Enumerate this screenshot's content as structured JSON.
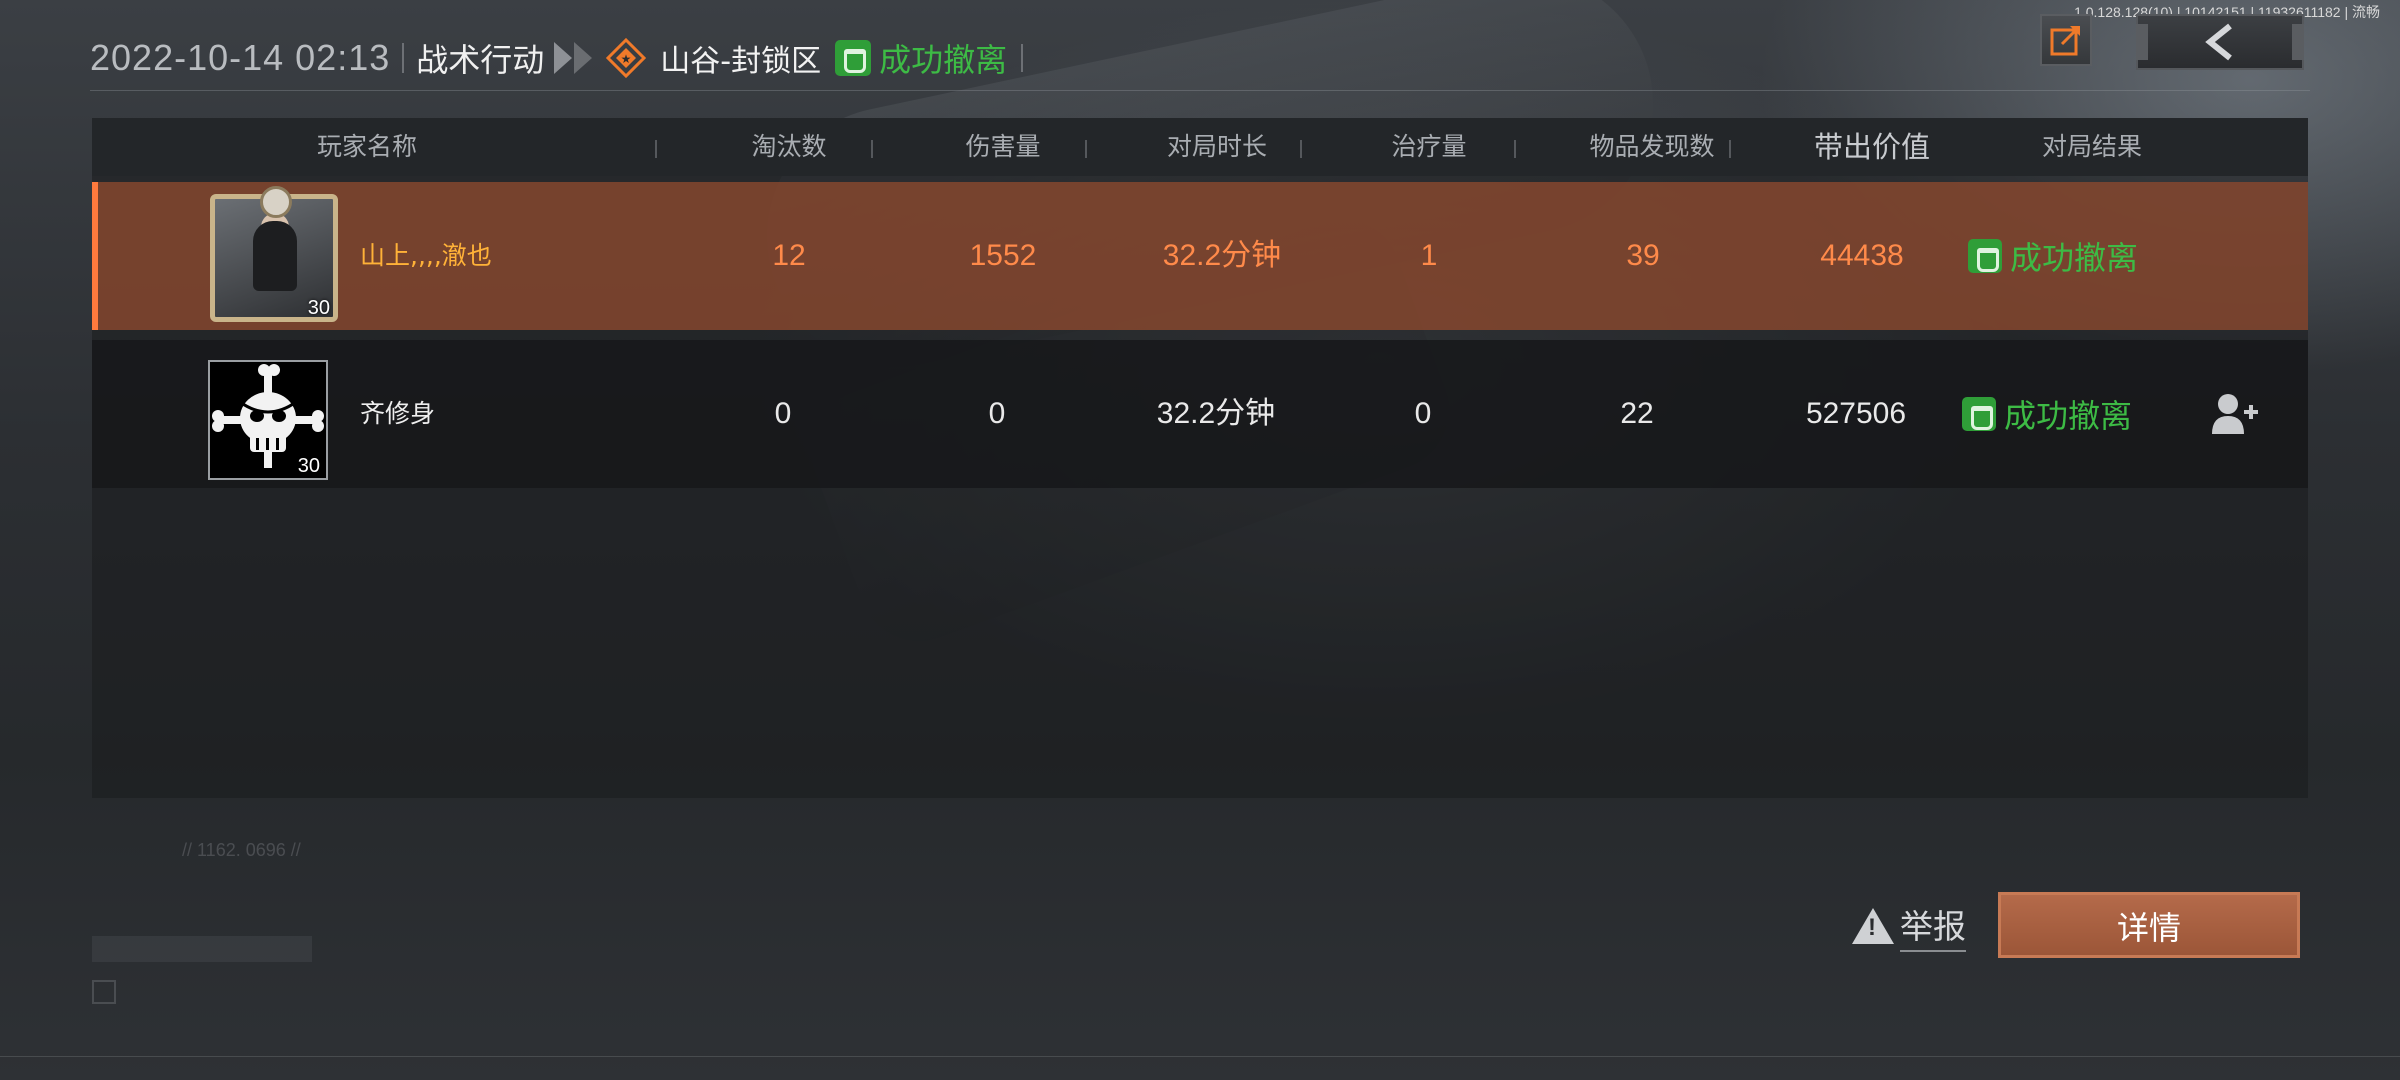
{
  "build_info": "1.0.128.128(10) | 10142151 | 11932611182 | 流畅",
  "header": {
    "datetime": "2022-10-14 02:13",
    "mode": "战术行动",
    "map": "山谷-封锁区",
    "result": "成功撤离"
  },
  "columns": [
    "玩家名称",
    "淘汰数",
    "伤害量",
    "对局时长",
    "治疗量",
    "物品发现数",
    "带出价值",
    "对局结果"
  ],
  "players": [
    {
      "name": "山上,,,,澈也",
      "level": "30",
      "kills": "12",
      "damage": "1552",
      "duration": "32.2分钟",
      "healing": "1",
      "items_found": "39",
      "value_extracted": "44438",
      "result": "成功撤离",
      "highlighted": true
    },
    {
      "name": "齐修身",
      "level": "30",
      "kills": "0",
      "damage": "0",
      "duration": "32.2分钟",
      "healing": "0",
      "items_found": "22",
      "value_extracted": "527506",
      "result": "成功撤离",
      "highlighted": false
    }
  ],
  "footer": {
    "match_code": "// 1162. 0696 //"
  },
  "actions": {
    "report": "举报",
    "details": "详情"
  },
  "icons": {
    "share": "share-icon",
    "back": "back-arrow-icon",
    "map": "map-diamond-icon",
    "extract": "extract-success-icon",
    "warning": "warning-icon",
    "add_friend": "add-friend-icon"
  },
  "colors": {
    "highlight_row": "#89482e",
    "success_green": "#3dbb45",
    "player_orange": "#ff8a4a",
    "name_gold": "#ffb238",
    "detail_button": "#a85e3f"
  }
}
